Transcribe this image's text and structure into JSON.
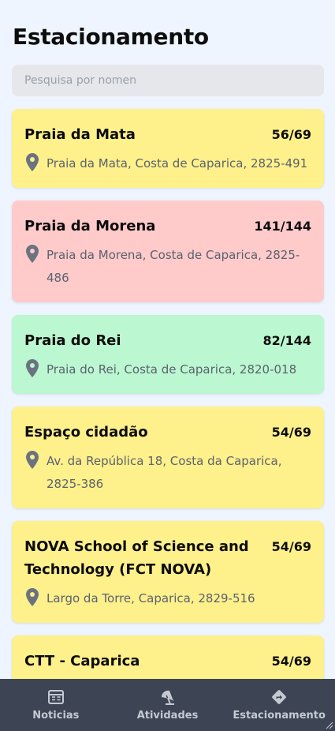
{
  "header": {
    "title": "Estacionamento"
  },
  "search": {
    "placeholder": "Pesquisa por nomen"
  },
  "parkings": [
    {
      "name": "Praia da Mata",
      "count": "56/69",
      "address": "Praia da Mata, Costa de Caparica, 2825-491",
      "status": "yellow"
    },
    {
      "name": "Praia da Morena",
      "count": "141/144",
      "address": "Praia da Morena, Costa de Caparica, 2825-486",
      "status": "red"
    },
    {
      "name": "Praia do Rei",
      "count": "82/144",
      "address": "Praia do Rei, Costa de Caparica, 2820-018",
      "status": "green"
    },
    {
      "name": "Espaço cidadão",
      "count": "54/69",
      "address": "Av. da República 18, Costa da Caparica, 2825-386",
      "status": "yellow"
    },
    {
      "name": "NOVA School of Science and Technology (FCT NOVA)",
      "count": "54/69",
      "address": "Largo da Torre, Caparica, 2829-516",
      "status": "yellow"
    },
    {
      "name": "CTT - Caparica",
      "count": "54/69",
      "address": "",
      "status": "yellow"
    }
  ],
  "status_colors": {
    "yellow": "#fef08a",
    "red": "#fecaca",
    "green": "#bbf7d0"
  },
  "nav": {
    "items": [
      {
        "label": "Noticias",
        "icon": "newspaper-icon"
      },
      {
        "label": "Atividades",
        "icon": "umbrella-beach-icon"
      },
      {
        "label": "Estacionamento",
        "icon": "directions-sign-icon"
      }
    ]
  }
}
